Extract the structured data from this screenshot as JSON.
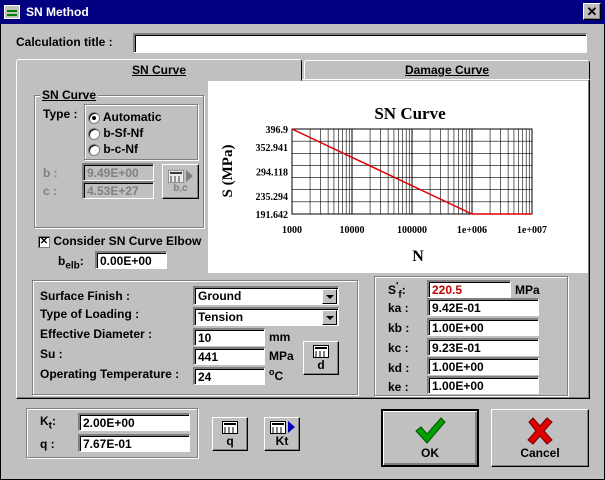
{
  "window": {
    "title": "SN Method",
    "close_glyph": "✕",
    "icon": "chart-app-icon"
  },
  "calc_title": {
    "label": "Calculation title :",
    "value": ""
  },
  "tabs": [
    {
      "label": "SN Curve",
      "active": true
    },
    {
      "label": "Damage Curve",
      "active": false
    }
  ],
  "sn_group": {
    "title": "SN Curve",
    "type_label": "Type :",
    "options": [
      {
        "label": "Automatic",
        "selected": true
      },
      {
        "label": "b-Sf-Nf",
        "selected": false
      },
      {
        "label": "b-c-Nf",
        "selected": false
      }
    ],
    "b_label": "b :",
    "b_value": "9.49E+00",
    "c_label": "c :",
    "c_value": "4.53E+27",
    "bc_button": "b,c"
  },
  "elbow": {
    "label": "Consider SN Curve Elbow",
    "checked": true,
    "check_glyph": "✕",
    "belb_label": "b",
    "belb_sub": "elb",
    "belb_colon": ":",
    "belb_value": "0.00E+00"
  },
  "chart_data": {
    "type": "line",
    "title": "SN Curve",
    "xlabel": "N",
    "ylabel": "S (MPa)",
    "xscale": "log",
    "xlim": [
      1000,
      10000000
    ],
    "ylim": [
      191.642,
      396.9
    ],
    "xticks": [
      "1000",
      "10000",
      "100000",
      "1e+006",
      "1e+007"
    ],
    "yticks": [
      "396.9",
      "352.941",
      "294.118",
      "235.294",
      "191.642"
    ],
    "grid": true,
    "line_color": "#e00000",
    "series": [
      {
        "points": [
          [
            1000,
            396.9
          ],
          [
            1000000,
            191.642
          ],
          [
            10000000,
            191.642
          ]
        ]
      }
    ]
  },
  "material": {
    "surface_label": "Surface Finish :",
    "surface_value": "Ground",
    "loading_label": "Type of Loading :",
    "loading_value": "Tension",
    "diameter_label": "Effective Diameter :",
    "diameter_value": "10",
    "diameter_unit": "mm",
    "su_label": "Su :",
    "su_value": "441",
    "su_unit": "MPa",
    "temp_label": "Operating Temperature :",
    "temp_value": "24",
    "temp_unit_o": "o",
    "temp_unit_c": "C",
    "d_button": "d"
  },
  "factors": {
    "sf_label": "S",
    "sf_sup": "'",
    "sf_sub": "f",
    "sf_colon": ":",
    "sf_value": "220.5",
    "sf_unit": "MPa",
    "rows": [
      {
        "label": "ka :",
        "value": "9.42E-01"
      },
      {
        "label": "kb :",
        "value": "1.00E+00"
      },
      {
        "label": "kc :",
        "value": "9.23E-01"
      },
      {
        "label": "kd :",
        "value": "1.00E+00"
      },
      {
        "label": "ke :",
        "value": "1.00E+00"
      }
    ]
  },
  "notch": {
    "kt_label": "K",
    "kt_sub": "t",
    "kt_colon": ":",
    "kt_value": "2.00E+00",
    "q_label": "q :",
    "q_value": "7.67E-01",
    "q_button": "q",
    "kt_button": "Kt"
  },
  "actions": {
    "ok": "OK",
    "cancel": "Cancel",
    "ok_color": "#00a000",
    "cancel_color": "#e00000"
  }
}
